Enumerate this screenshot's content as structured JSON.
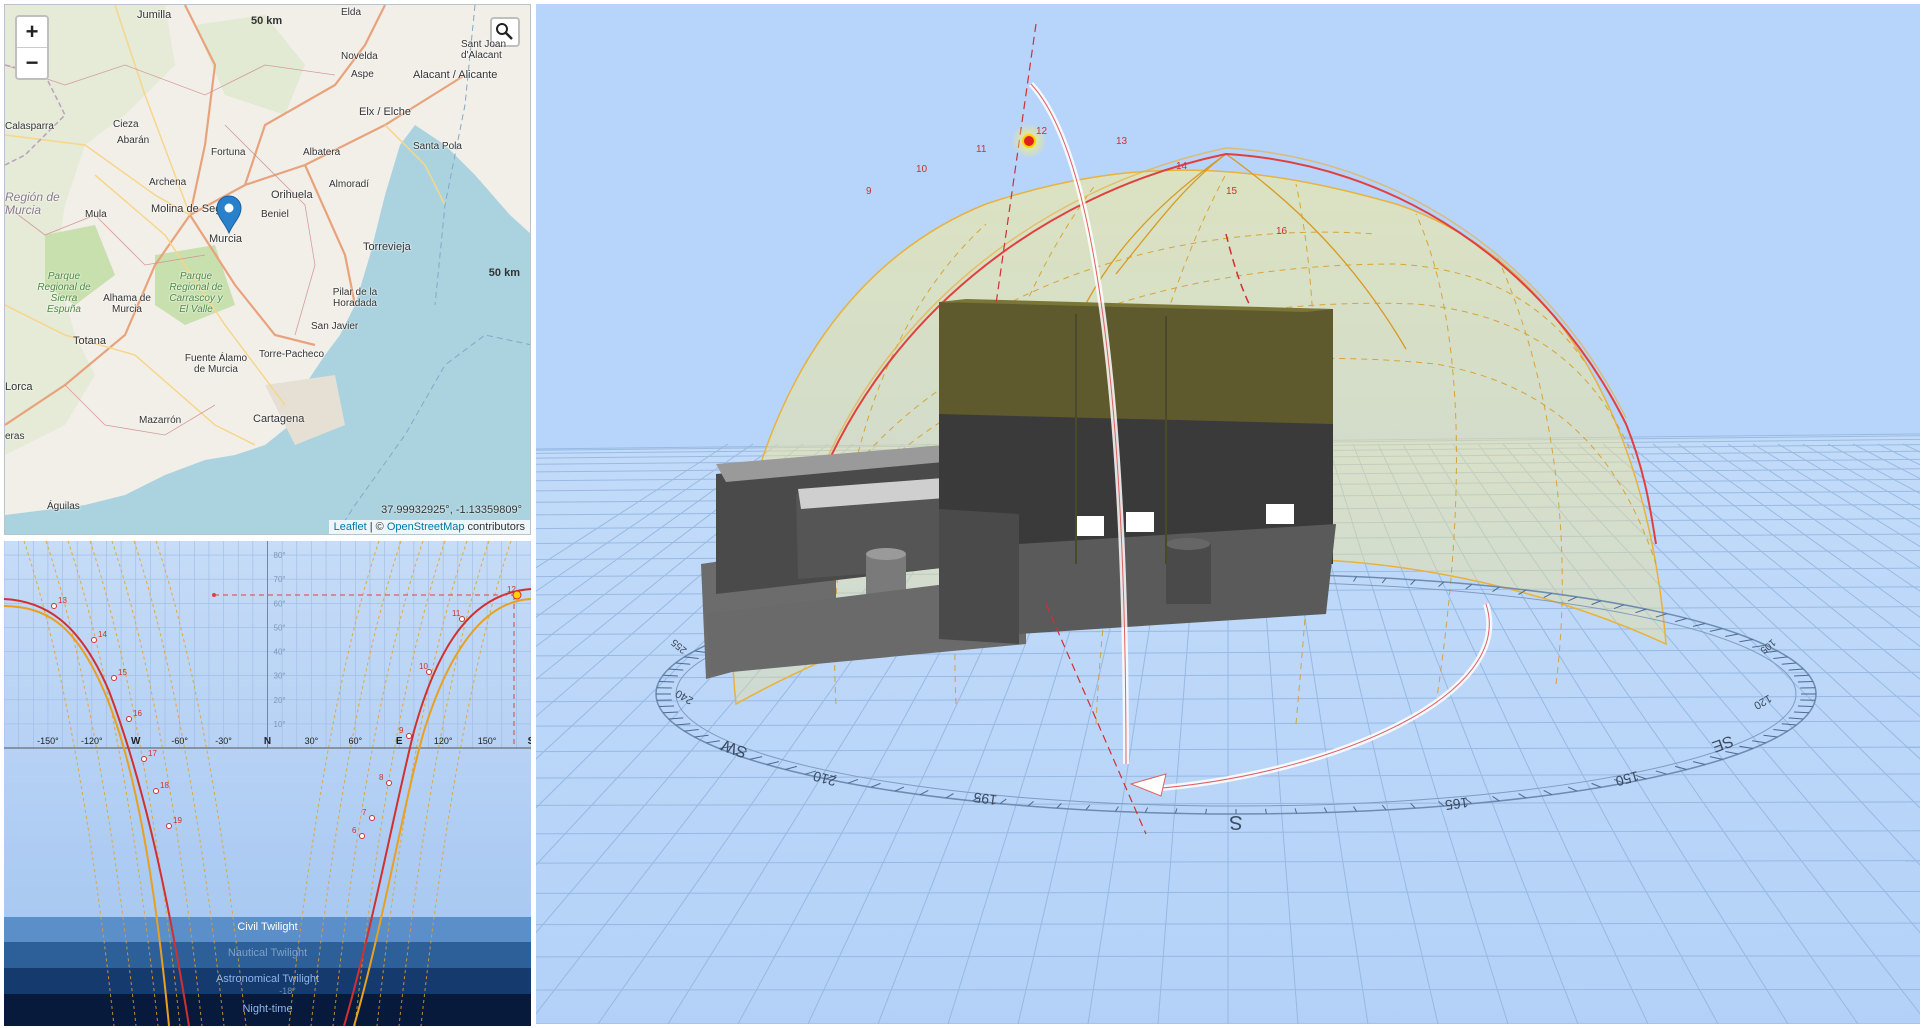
{
  "map": {
    "zoom_in_label": "+",
    "zoom_out_label": "−",
    "search_icon": "search-icon",
    "scale_top": "50 km",
    "scale_right": "50 km",
    "coordinates": "37.99932925°, -1.13359809°",
    "attribution": {
      "leaflet": "Leaflet",
      "separator": " | © ",
      "osm": "OpenStreetMap",
      "suffix": " contributors"
    },
    "marker_icon": "map-pin-icon",
    "places": {
      "jumilla": "Jumilla",
      "elda": "Elda",
      "novelda": "Novelda",
      "aspe": "Aspe",
      "santjoan": "Sant Joan d'Alacant",
      "alacant": "Alacant / Alicante",
      "elx": "Elx / Elche",
      "santapola": "Santa Pola",
      "albatera": "Albatera",
      "almoradi": "Almoradí",
      "orihuela": "Orihuela",
      "beniel": "Beniel",
      "torrevieja": "Torrevieja",
      "molina": "Molina de Segura",
      "murcia": "Murcia",
      "fortuna": "Fortuna",
      "archena": "Archena",
      "cieza": "Cieza",
      "abaran": "Abarán",
      "calasparra": "Calasparra",
      "mula": "Mula",
      "alhama": "Alhama de Murcia",
      "totana": "Totana",
      "fuente": "Fuente Álamo de Murcia",
      "torrepacheco": "Torre-Pacheco",
      "pilar": "Pilar de la Horadada",
      "sanjavier": "San Javier",
      "cartagena": "Cartagena",
      "mazarron": "Mazarrón",
      "lorca": "Lorca",
      "aguilas": "Águilas",
      "eras": "eras",
      "region": "Región de Murcia",
      "parque1": "Parque Regional de Sierra Espuña",
      "parque2": "Parque Regional de Carrascoy y El Valle"
    }
  },
  "sun_chart": {
    "x_labels": [
      "-150°",
      "-120°",
      "W",
      "-60°",
      "-30°",
      "N",
      "30°",
      "60°",
      "E",
      "120°",
      "150°",
      "S"
    ],
    "y_labels": [
      "10°",
      "20°",
      "30°",
      "40°",
      "50°",
      "60°",
      "70°",
      "80°"
    ],
    "hour_labels_left": [
      "13",
      "14",
      "15",
      "16",
      "17",
      "18",
      "19"
    ],
    "hour_labels_right": [
      "12",
      "11",
      "10",
      "9",
      "8",
      "7",
      "6"
    ],
    "bands": {
      "civil": "Civil Twilight",
      "nautical": "Nautical Twilight",
      "astronomical": "Astronomical Twilight",
      "night": "Night-time",
      "band_value": "-18°"
    },
    "colors": {
      "sun_path": "#d03030",
      "analemma": "#e8a020",
      "civil": "#5b8fc9",
      "nautical": "#2d5f98",
      "astronomical": "#153a6e",
      "night": "#071a3c"
    }
  },
  "view3d": {
    "compass": {
      "S": "S",
      "SW": "SW",
      "SE": "SE",
      "ticks": [
        "195",
        "210",
        "165",
        "150",
        "240",
        "120",
        "255",
        "105"
      ]
    },
    "dome_hours": [
      "12",
      "13",
      "14",
      "11",
      "10",
      "15",
      "9",
      "16"
    ],
    "colors": {
      "sky": "#b7d4fb",
      "dome": "#f0e890",
      "sun": "#e02020",
      "building": "#5a5a5a"
    }
  }
}
